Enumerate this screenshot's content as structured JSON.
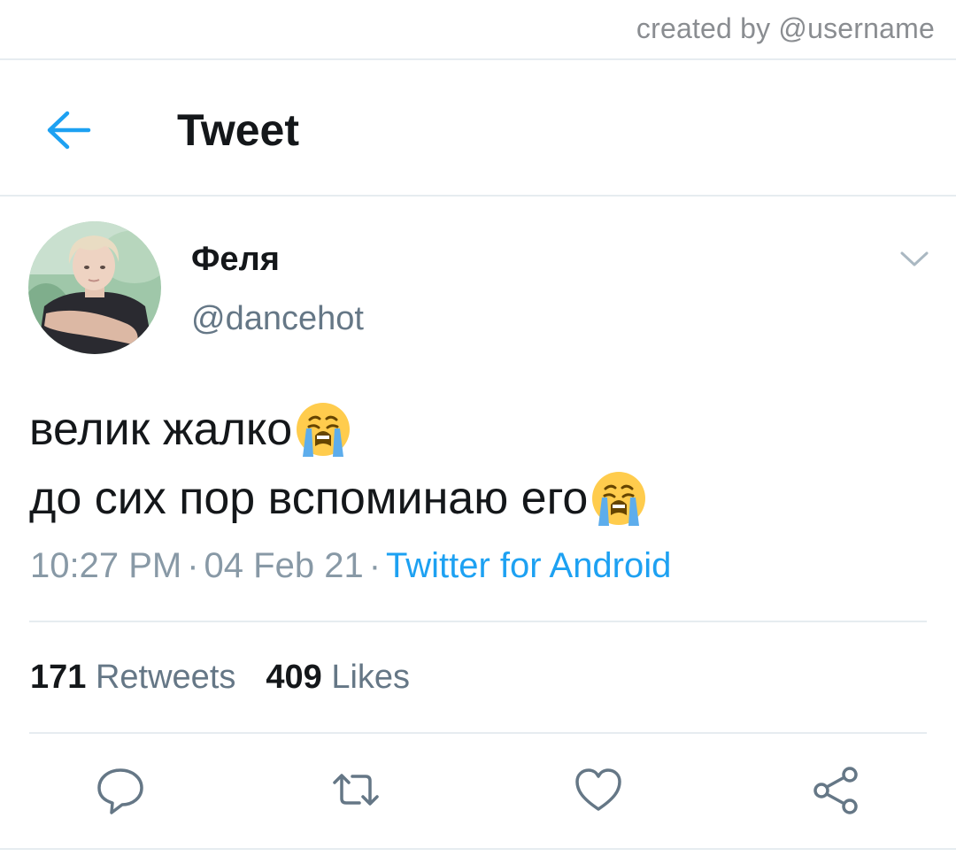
{
  "watermark": "created by @username",
  "header": {
    "title": "Tweet",
    "back_icon": "arrow-left-icon"
  },
  "author": {
    "name": "Феля",
    "handle": "@dancehot"
  },
  "tweet": {
    "lines": [
      "велик жалко",
      "до сих пор вспоминаю его"
    ],
    "emoji": "loudly-crying-face"
  },
  "meta": {
    "time": "10:27 PM",
    "separator": "·",
    "date": "04 Feb 21",
    "source": "Twitter for Android"
  },
  "stats": {
    "retweets_count": "171",
    "retweets_label": "Retweets",
    "likes_count": "409",
    "likes_label": "Likes"
  },
  "actions": [
    "reply-icon",
    "retweet-icon",
    "like-icon",
    "share-icon"
  ],
  "colors": {
    "accent": "#1da1f2",
    "text": "#14171a",
    "secondary": "#657786",
    "divider": "#e6ecf0"
  }
}
